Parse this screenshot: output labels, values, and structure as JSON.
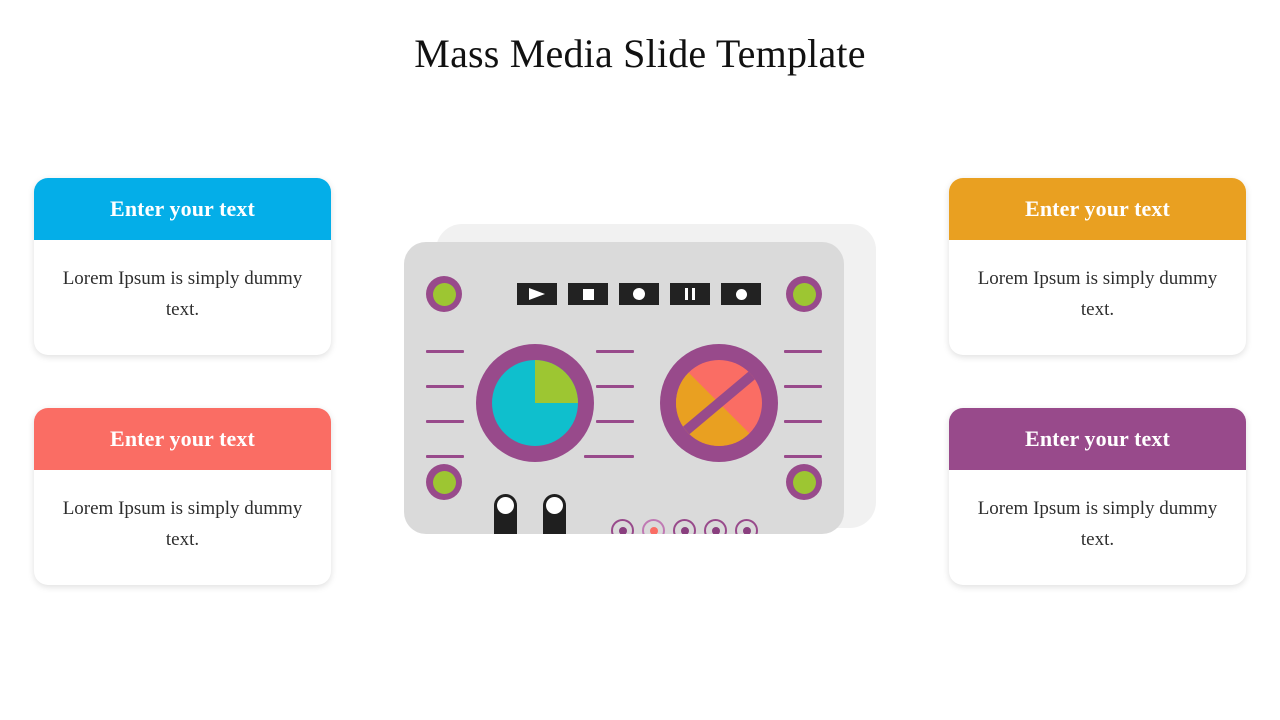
{
  "slide": {
    "title": "Mass Media Slide Template",
    "background_color": "#ffffff"
  },
  "cards": [
    {
      "id": "card-tl",
      "position": "top-left",
      "header_label": "Enter your text",
      "body_text": "Lorem Ipsum is simply dummy text.",
      "header_color": "#04aee8"
    },
    {
      "id": "card-bl",
      "position": "bottom-left",
      "header_label": "Enter your text",
      "body_text": "Lorem Ipsum is simply dummy text.",
      "header_color": "#fa6d64"
    },
    {
      "id": "card-tr",
      "position": "top-right",
      "header_label": "Enter your text",
      "body_text": "Lorem Ipsum is simply dummy text.",
      "header_color": "#e9a021"
    },
    {
      "id": "card-br",
      "position": "bottom-right",
      "header_label": "Enter your text",
      "body_text": "Lorem Ipsum is simply dummy text.",
      "header_color": "#984a8b"
    }
  ],
  "mixer": {
    "name": "mass-media-mixer-illustration",
    "body_color": "#dadada",
    "shadow_color": "#f1f1f1",
    "accent_purple": "#984a8b",
    "accent_green": "#9dc632",
    "accent_cyan": "#0fbfcd",
    "accent_salmon": "#fa6d64",
    "accent_orange": "#e9a021",
    "corner_knobs": [
      {
        "id": "knob-tl",
        "icon": "round-knob-icon"
      },
      {
        "id": "knob-tr",
        "icon": "round-knob-icon"
      },
      {
        "id": "knob-bl",
        "icon": "round-knob-icon"
      },
      {
        "id": "knob-br",
        "icon": "round-knob-icon"
      }
    ],
    "transport_buttons": [
      {
        "id": "play",
        "icon": "play-icon"
      },
      {
        "id": "stop",
        "icon": "stop-icon"
      },
      {
        "id": "record",
        "icon": "record-icon"
      },
      {
        "id": "pause",
        "icon": "pause-icon"
      },
      {
        "id": "dot",
        "icon": "record-dot-icon"
      }
    ],
    "slider_groups": [
      {
        "id": "lines-left",
        "count": 4
      },
      {
        "id": "lines-mid",
        "count": 4
      },
      {
        "id": "lines-right",
        "count": 4
      }
    ],
    "dials": [
      {
        "id": "bigknob-left",
        "icon": "pie-dial-icon",
        "base_color": "#0fbfcd",
        "segment_color": "#9dc632",
        "segment_degrees": 90
      },
      {
        "id": "bigknob-right",
        "icon": "split-dial-icon",
        "upper_color": "#fa6d64",
        "lower_color": "#e9a021",
        "divider_color": "#984a8b"
      }
    ],
    "toggle_switches": [
      {
        "id": "switch-1",
        "icon": "toggle-switch-icon"
      },
      {
        "id": "switch-2",
        "icon": "toggle-switch-icon"
      }
    ],
    "leds": [
      {
        "id": "led-1",
        "active": false
      },
      {
        "id": "led-2",
        "active": true
      },
      {
        "id": "led-3",
        "active": false
      },
      {
        "id": "led-4",
        "active": false
      },
      {
        "id": "led-5",
        "active": false
      }
    ]
  }
}
